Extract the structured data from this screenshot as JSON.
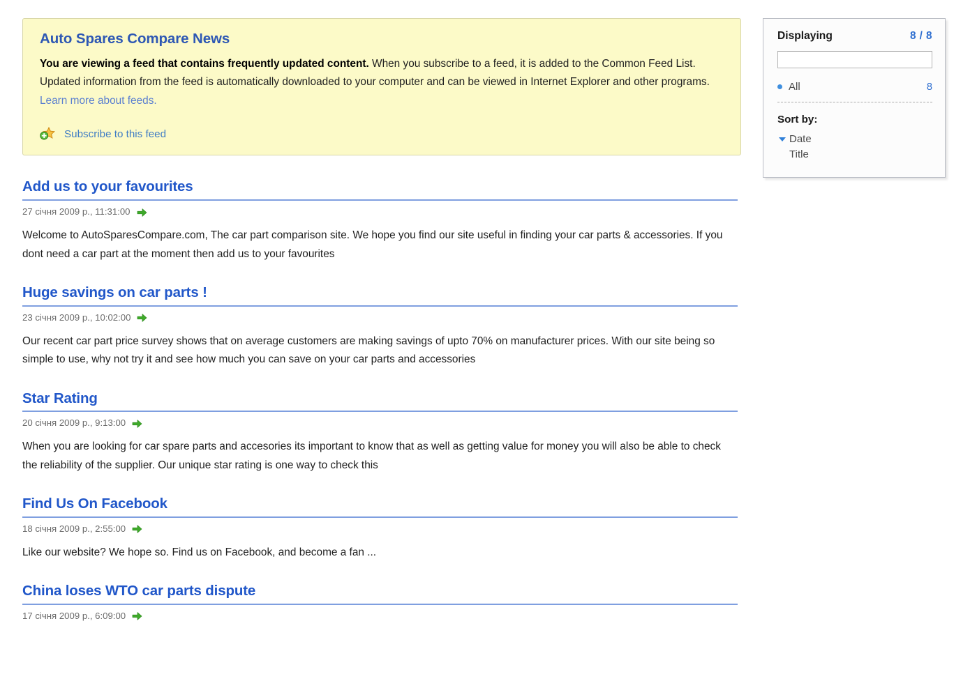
{
  "banner": {
    "title": "Auto Spares Compare News",
    "lead": "You are viewing a feed that contains frequently updated content.",
    "description": " When you subscribe to a feed, it is added to the Common Feed List. Updated information from the feed is automatically downloaded to your computer and can be viewed in Internet Explorer and other programs. ",
    "learn_more_link": "Learn more about feeds.",
    "subscribe_label": "Subscribe to this feed",
    "subscribe_icon": "subscribe-star-icon"
  },
  "articles": [
    {
      "title": "Add us to your favourites",
      "date": "27 січня 2009 р., 11:31:00",
      "arrow_icon": "green-arrow-icon",
      "body": "Welcome to AutoSparesCompare.com, The car part comparison site. We hope you find our site useful in finding your car parts & accessories. If you dont need a car part at the moment then add us to your favourites"
    },
    {
      "title": "Huge savings on car parts !",
      "date": "23 січня 2009 р., 10:02:00",
      "arrow_icon": "green-arrow-icon",
      "body": "Our recent car part price survey shows that on average customers are making savings of upto 70% on manufacturer prices. With our site being so simple to use, why not try it and see how much you can save on your car parts and accessories"
    },
    {
      "title": "Star Rating",
      "date": "20 січня 2009 р., 9:13:00",
      "arrow_icon": "green-arrow-icon",
      "body": "When you are looking for car spare parts and accesories its important to know that as well as getting value for money you will also be able to check the reliability of the supplier. Our unique star rating is one way to check this"
    },
    {
      "title": "Find Us On Facebook",
      "date": "18 січня 2009 р., 2:55:00",
      "arrow_icon": "green-arrow-icon",
      "body": "Like our website? We hope so. Find us on Facebook, and become a fan ..."
    },
    {
      "title": "China loses WTO car parts dispute",
      "date": "17 січня 2009 р., 6:09:00",
      "arrow_icon": "green-arrow-icon",
      "body": ""
    }
  ],
  "sidebar": {
    "displaying_label": "Displaying",
    "displaying_count": "8 / 8",
    "search_value": "",
    "search_placeholder": "",
    "filter": {
      "label": "All",
      "count": "8",
      "bullet_icon": "blue-dot-icon"
    },
    "sort_label": "Sort by:",
    "sort_options": [
      {
        "label": "Date",
        "marker_icon": "caret-down-icon"
      },
      {
        "label": "Title",
        "marker_icon": ""
      }
    ]
  },
  "colors": {
    "banner_background": "#fcfac8",
    "banner_border": "#d8d6a8",
    "title_blue": "#2157c9",
    "link_blue": "#5a7fd0",
    "rule_blue": "#7f9fe0",
    "accent_blue": "#2f6fd0",
    "arrow_green": "#3faa2a",
    "star_orange": "#f0a830"
  }
}
